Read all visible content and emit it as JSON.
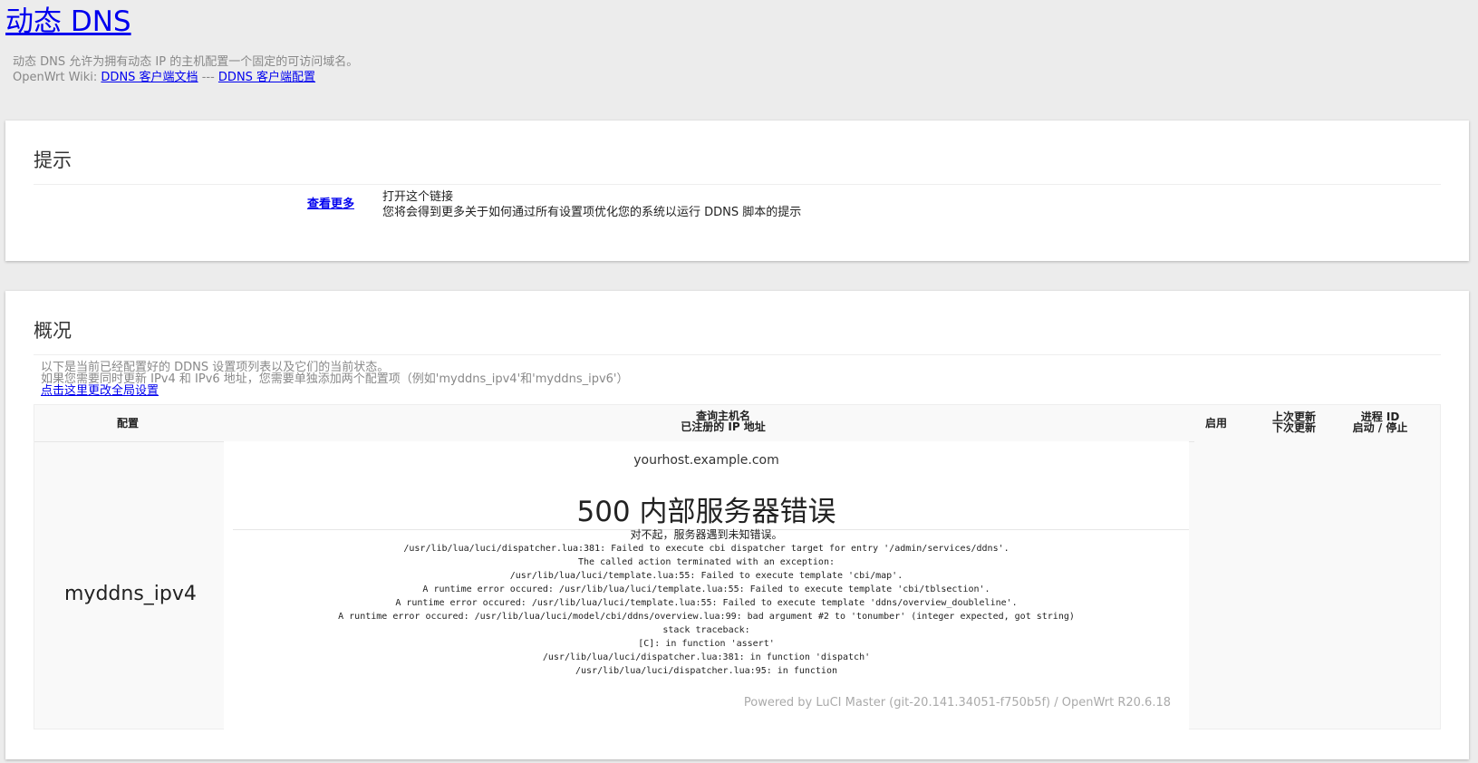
{
  "header": {
    "title": "动态 DNS",
    "desc_line1": "动态 DNS 允许为拥有动态 IP 的主机配置一个固定的可访问域名。",
    "wiki_prefix": "OpenWrt Wiki:",
    "wiki_link1": "DDNS 客户端文档",
    "wiki_sep": "---",
    "wiki_link2": "DDNS 客户端配置"
  },
  "tips": {
    "title": "提示",
    "link": "查看更多",
    "line1": "打开这个链接",
    "line2": "您将会得到更多关于如何通过所有设置项优化您的系统以运行 DDNS 脚本的提示"
  },
  "overview": {
    "title": "概况",
    "desc1": "以下是当前已经配置好的 DDNS 设置项列表以及它们的当前状态。",
    "desc2": "如果您需要同时更新 IPv4 和 IPv6 地址，您需要单独添加两个配置项（例如'myddns_ipv4'和'myddns_ipv6'）",
    "global_link": "点击这里更改全局设置",
    "columns": {
      "config": "配置",
      "host1": "查询主机名",
      "host2": "已注册的 IP 地址",
      "enable": "启用",
      "last1": "上次更新",
      "last2": "下次更新",
      "pid1": "进程 ID",
      "pid2": "启动 / 停止"
    },
    "row": {
      "config": "myddns_ipv4",
      "hostname": "yourhost.example.com"
    },
    "error": {
      "title": "500 内部服务器错误",
      "first": "对不起，服务器遇到未知错误。",
      "lines": [
        "/usr/lib/lua/luci/dispatcher.lua:381: Failed to execute cbi dispatcher target for entry '/admin/services/ddns'.",
        "The called action terminated with an exception:",
        "/usr/lib/lua/luci/template.lua:55: Failed to execute template 'cbi/map'.",
        "A runtime error occured: /usr/lib/lua/luci/template.lua:55: Failed to execute template 'cbi/tblsection'.",
        "A runtime error occured: /usr/lib/lua/luci/template.lua:55: Failed to execute template 'ddns/overview_doubleline'.",
        "A runtime error occured: /usr/lib/lua/luci/model/cbi/ddns/overview.lua:99: bad argument #2 to 'tonumber' (integer expected, got string)",
        "stack traceback:",
        "[C]: in function 'assert'",
        "/usr/lib/lua/luci/dispatcher.lua:381: in function 'dispatch'",
        "/usr/lib/lua/luci/dispatcher.lua:95: in function"
      ],
      "powered": "Powered by LuCI Master (git-20.141.34051-f750b5f) / OpenWrt R20.6.18"
    }
  }
}
